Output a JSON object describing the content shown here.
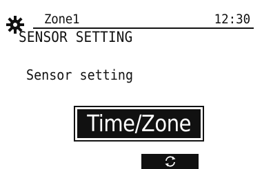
{
  "header": {
    "zone": "Zone1",
    "time": "12:30",
    "title": "SENSOR SETTING",
    "icon": "gear-icon"
  },
  "main": {
    "caption": "Sensor setting",
    "selected_value": "Time/Zone"
  },
  "footer": {
    "function_key_icon": "refresh-icon"
  },
  "colors": {
    "foreground": "#111111",
    "background": "#ffffff",
    "highlight_text": "#ffffff"
  }
}
